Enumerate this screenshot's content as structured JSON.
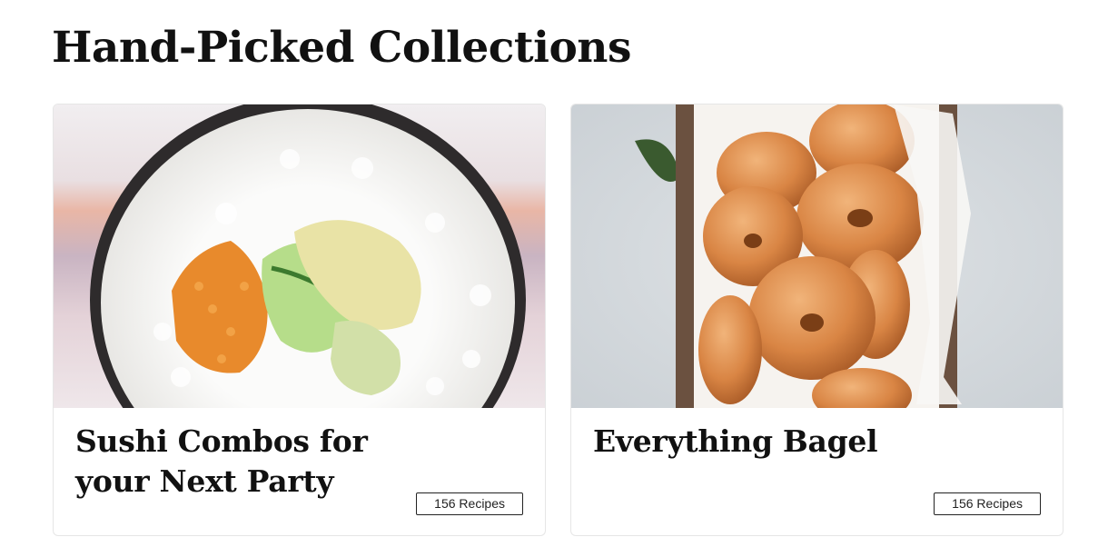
{
  "page": {
    "title": "Hand-Picked Collections"
  },
  "collections": [
    {
      "title": "Sushi Combos for your Next Party",
      "recipe_count": "156 Recipes",
      "image_subject": "sushi roll cross-section"
    },
    {
      "title": "Everything Bagel",
      "recipe_count": "156 Recipes",
      "image_subject": "bagels in a wicker basket"
    }
  ]
}
